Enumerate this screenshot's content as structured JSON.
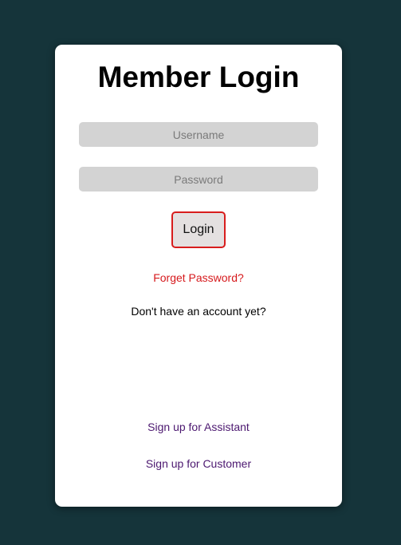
{
  "login_card": {
    "title": "Member Login",
    "username": {
      "value": "",
      "placeholder": "Username"
    },
    "password": {
      "value": "",
      "placeholder": "Password"
    },
    "login_label": "Login",
    "forgot_password_label": "Forget Password?",
    "no_account_text": "Don't have an account yet?",
    "signup_assistant_label": "Sign up for Assistant",
    "signup_customer_label": "Sign up for Customer"
  },
  "colors": {
    "background": "#15343a",
    "card": "#ffffff",
    "input_fill": "#d3d3d3",
    "login_border": "#d81d1d",
    "forgot_link": "#d6191c",
    "signup_link": "#4c1870"
  }
}
